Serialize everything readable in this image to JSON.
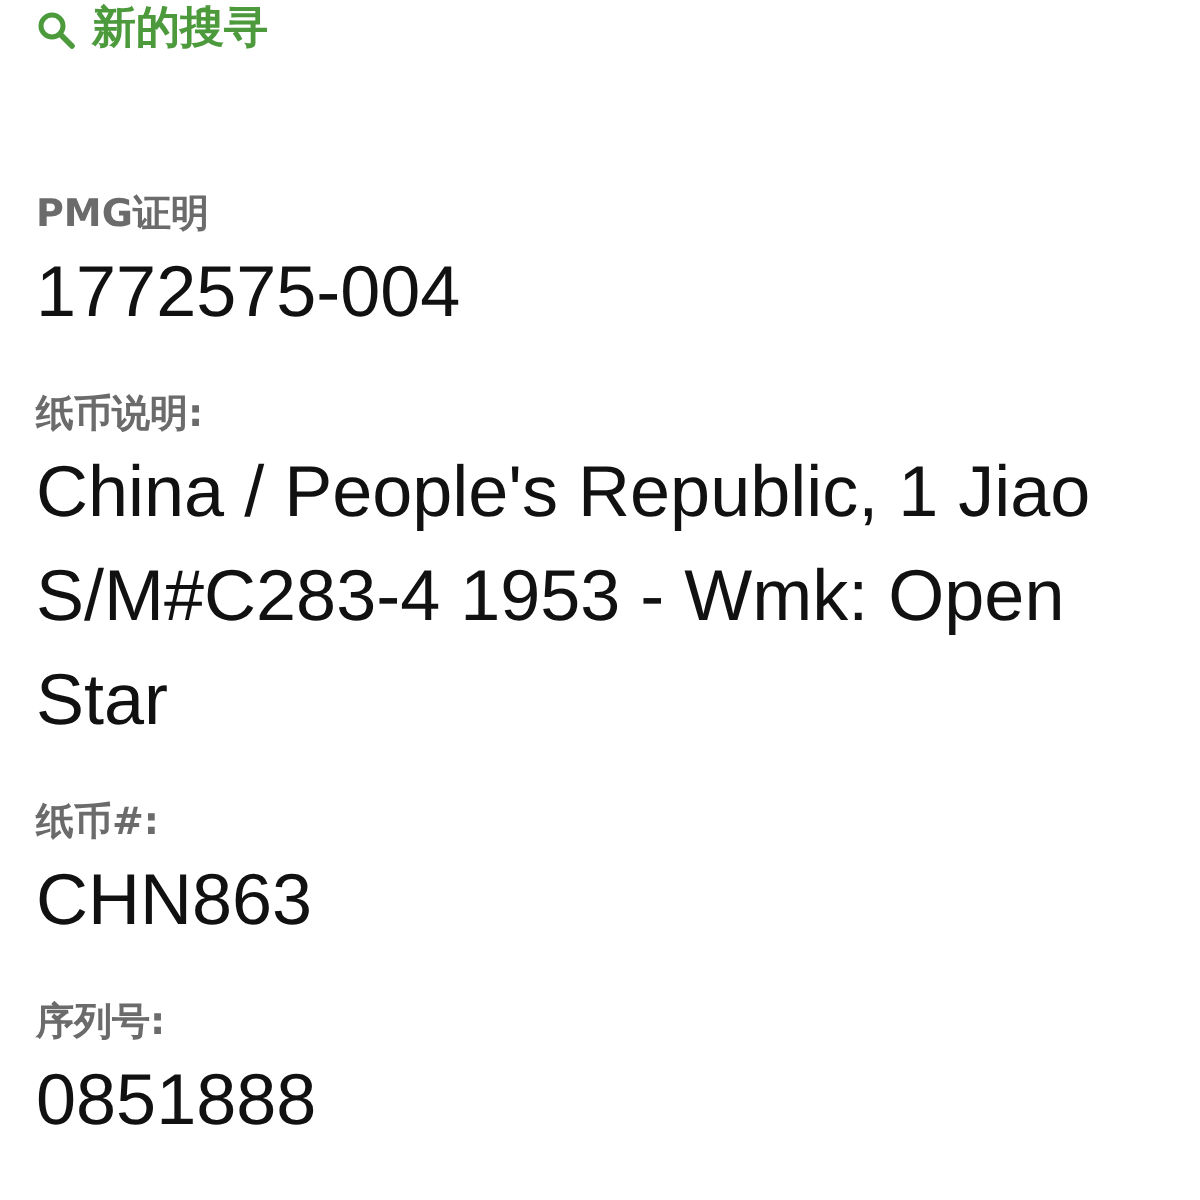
{
  "search_link": {
    "label": "新的搜寻"
  },
  "fields": [
    {
      "label": "PMG证明",
      "value": "1772575-004"
    },
    {
      "label": "纸币说明:",
      "value": "China / People's Republic, 1 Jiao S/M#C283-4 1953 - Wmk: Open Star"
    },
    {
      "label": "纸币#:",
      "value": "CHN863"
    },
    {
      "label": "序列号:",
      "value": "0851888"
    }
  ]
}
